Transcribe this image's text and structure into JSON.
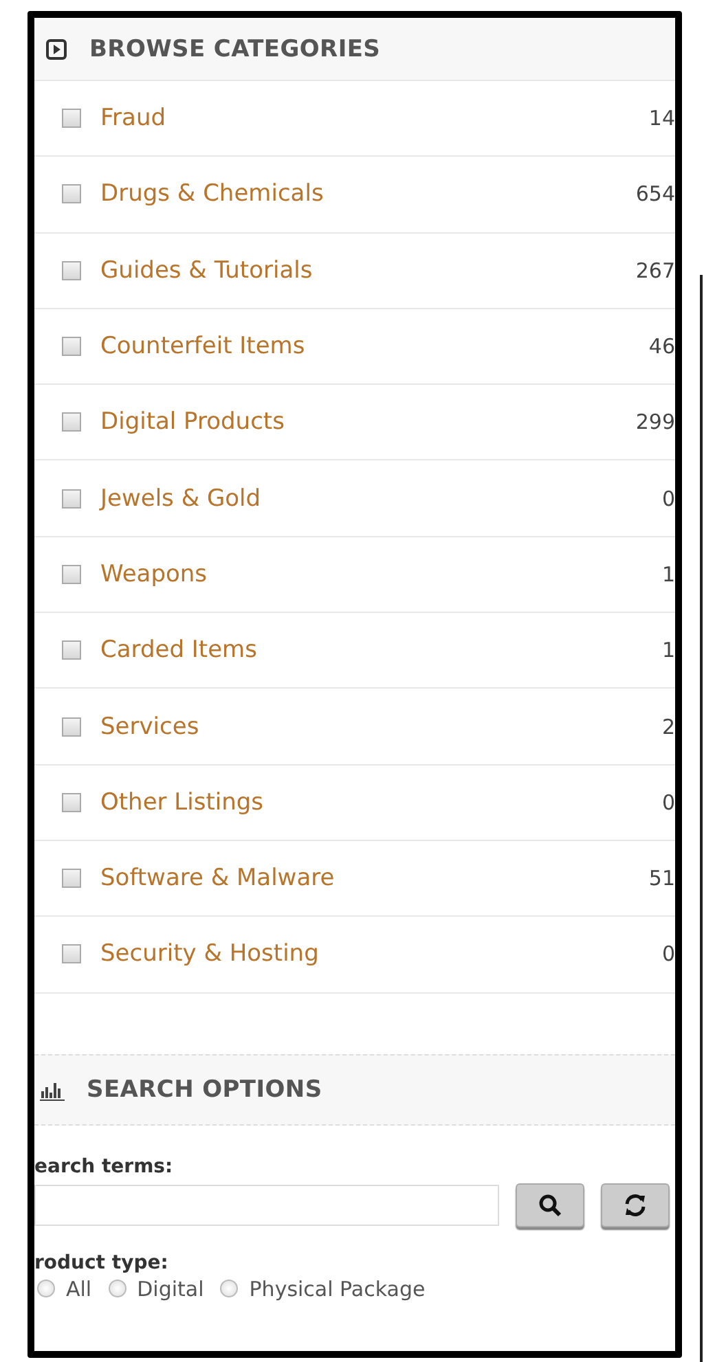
{
  "browse": {
    "title": "BROWSE CATEGORIES",
    "categories": [
      {
        "label": "Fraud",
        "count": "14",
        "checked": false
      },
      {
        "label": "Drugs & Chemicals",
        "count": "654",
        "checked": false
      },
      {
        "label": "Guides & Tutorials",
        "count": "267",
        "checked": false
      },
      {
        "label": "Counterfeit Items",
        "count": "46",
        "checked": false
      },
      {
        "label": "Digital Products",
        "count": "299",
        "checked": false
      },
      {
        "label": "Jewels & Gold",
        "count": "0",
        "checked": false
      },
      {
        "label": "Weapons",
        "count": "1",
        "checked": false
      },
      {
        "label": "Carded Items",
        "count": "1",
        "checked": false
      },
      {
        "label": "Services",
        "count": "2",
        "checked": false
      },
      {
        "label": "Other Listings",
        "count": "0",
        "checked": false
      },
      {
        "label": "Software & Malware",
        "count": "51",
        "checked": false
      },
      {
        "label": "Security & Hosting",
        "count": "0",
        "checked": false
      }
    ]
  },
  "search": {
    "title": "SEARCH OPTIONS",
    "terms_label": "earch terms:",
    "product_type_label": "roduct type:",
    "product_types": [
      {
        "label": "All",
        "selected": false
      },
      {
        "label": "Digital",
        "selected": false
      },
      {
        "label": "Physical Package",
        "selected": false
      }
    ]
  }
}
